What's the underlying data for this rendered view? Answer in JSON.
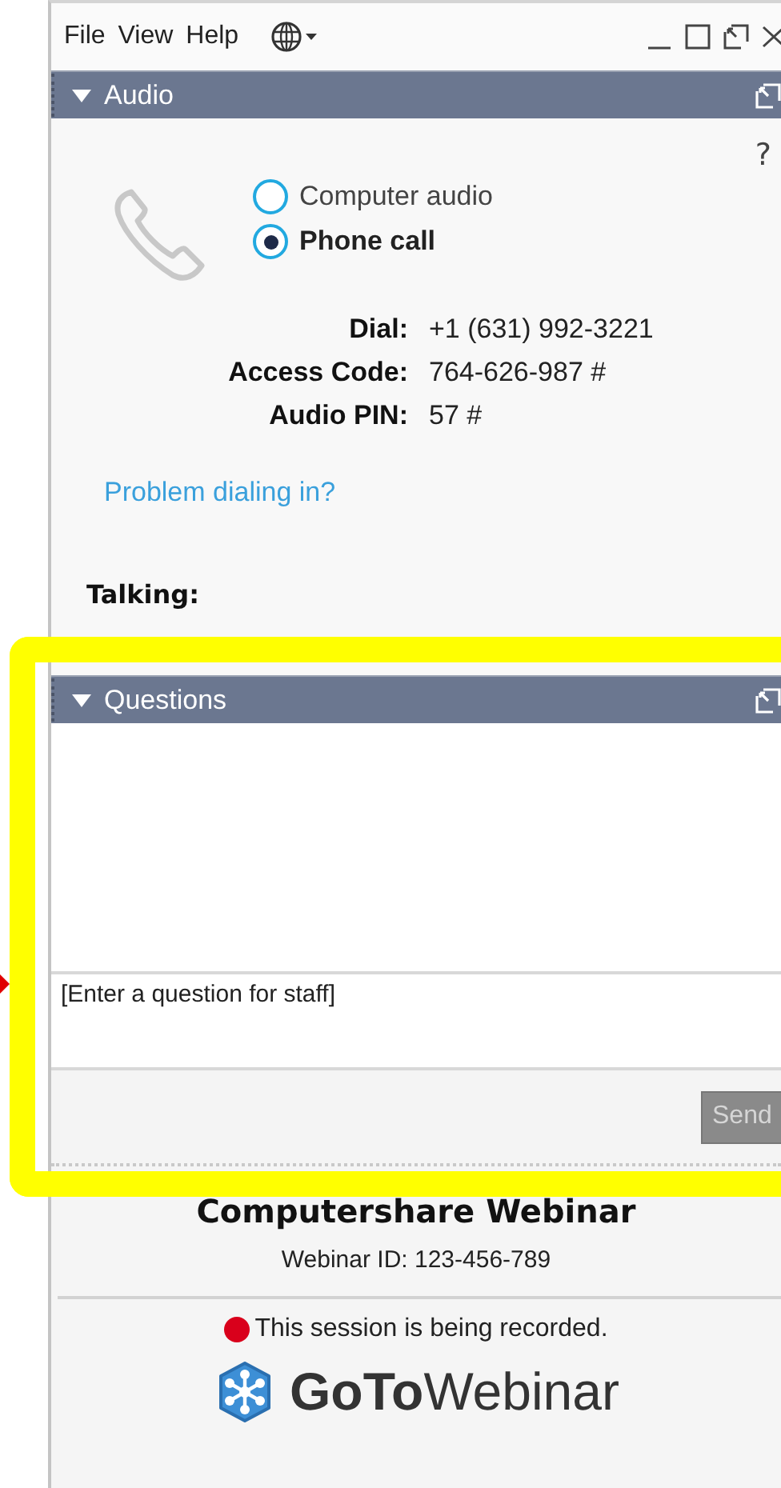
{
  "menu": {
    "items": [
      {
        "label": "File"
      },
      {
        "label": "View"
      },
      {
        "label": "Help"
      }
    ]
  },
  "audio_panel": {
    "title": "Audio",
    "expanded": true,
    "help": "?",
    "modes": [
      {
        "label": "Computer audio",
        "selected": false
      },
      {
        "label": "Phone call",
        "selected": true
      }
    ],
    "details": [
      {
        "label": "Dial:",
        "value": "+1 (631) 992-3221"
      },
      {
        "label": "Access Code:",
        "value": "764-626-987 #"
      },
      {
        "label": "Audio PIN:",
        "value": "57 #"
      }
    ],
    "link": "Problem dialing in?",
    "talking": "Talking:"
  },
  "questions_panel": {
    "title": "Questions",
    "expanded": true,
    "placeholder": "[Enter a question for staff]",
    "send": {
      "label": "Send",
      "disabled": true
    }
  },
  "footer": {
    "title": "Computershare Webinar",
    "webinar_id": "Webinar ID: 123-456-789",
    "recording": "This session is being recorded.",
    "logo": "**GoTo**Webinar"
  }
}
